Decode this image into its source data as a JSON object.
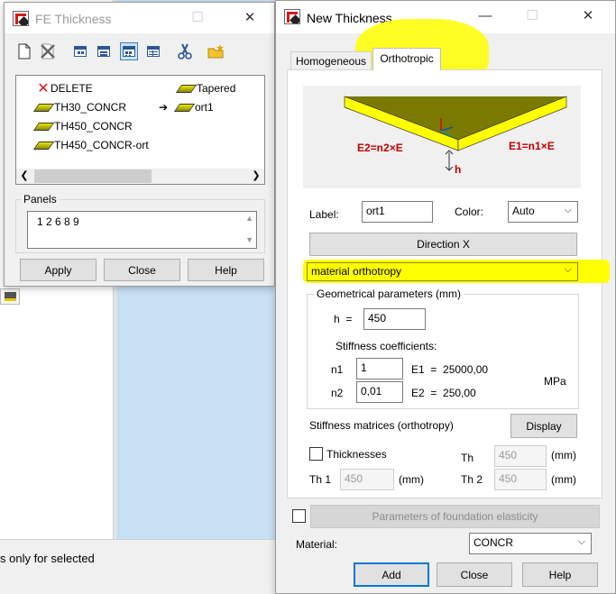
{
  "background": {
    "status_note": "s only for selected"
  },
  "fe_window": {
    "title": "FE Thickness",
    "toolbar_icons": [
      "new-icon",
      "delete-icon",
      "view-small-icon",
      "view-list-icon",
      "view-large-icon",
      "view-details-icon",
      "cut-icon",
      "open-folder-icon"
    ],
    "list": {
      "items": [
        {
          "label": "DELETE",
          "icon": "delete-x-icon"
        },
        {
          "label": "TH30_CONCR",
          "icon": "plate-icon"
        },
        {
          "label": "TH450_CONCR",
          "icon": "plate-icon"
        },
        {
          "label": "TH450_CONCR-ort",
          "icon": "plate-icon"
        },
        {
          "label": "Tapered",
          "icon": "plate-icon"
        },
        {
          "label": "ort1",
          "icon": "plate-icon",
          "current": true
        }
      ]
    },
    "panels_label": "Panels",
    "panels_value": "1 2 6 8 9",
    "buttons": {
      "apply": "Apply",
      "close": "Close",
      "help": "Help"
    }
  },
  "nt_window": {
    "title": "New Thickness",
    "tabs": [
      {
        "label": "Homogeneous"
      },
      {
        "label": "Orthotropic",
        "active": true
      }
    ],
    "diagram": {
      "e2": "E2=n2×E",
      "e1": "E1=n1×E",
      "h": "h"
    },
    "label_caption": "Label:",
    "label_value": "ort1",
    "color_caption": "Color:",
    "color_value": "Auto",
    "direction_button": "Direction X",
    "type_value": "material orthotropy",
    "geom_group": "Geometrical parameters (mm)",
    "h_caption": "h  =",
    "h_value": "450",
    "stiffness_caption": "Stiffness coefficients:",
    "n1_caption": "n1",
    "n1_value": "1",
    "e1_text": "E1  =  25000,00",
    "n2_caption": "n2",
    "n2_value": "0,01",
    "e2_text": "E2  =  250,00",
    "unit_mpa": "MPa",
    "matrices_caption": "Stiffness matrices (orthotropy)",
    "display_button": "Display",
    "thicknesses_caption": "Thicknesses",
    "th_caption": "Th",
    "th_value": "450",
    "th_unit": "(mm)",
    "th1_caption": "Th 1",
    "th1_value": "450",
    "th1_unit": "(mm)",
    "th2_caption": "Th 2",
    "th2_value": "450",
    "th2_unit": "(mm)",
    "foundation_button": "Parameters of foundation elasticity",
    "material_caption": "Material:",
    "material_value": "CONCR",
    "buttons": {
      "add": "Add",
      "close": "Close",
      "help": "Help"
    }
  },
  "colors": {
    "highlight": "#ffff00",
    "focus_blue": "#0078d7",
    "plate_yellow": "#ffff00",
    "plate_top": "#7a7a00",
    "label_red": "#c00000"
  }
}
